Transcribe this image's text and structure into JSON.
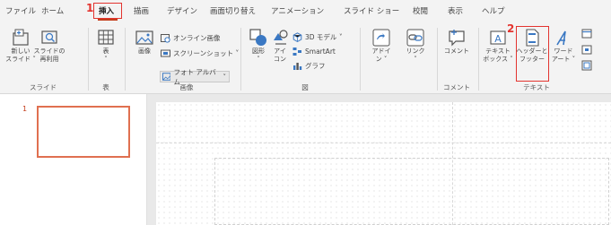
{
  "tabs": [
    {
      "id": "file",
      "label": "ファイル"
    },
    {
      "id": "home",
      "label": "ホーム"
    },
    {
      "id": "insert",
      "label": "挿入"
    },
    {
      "id": "draw",
      "label": "描画"
    },
    {
      "id": "design",
      "label": "デザイン"
    },
    {
      "id": "transitions",
      "label": "画面切り替え"
    },
    {
      "id": "animations",
      "label": "アニメーション"
    },
    {
      "id": "slideshow",
      "label": "スライド ショー"
    },
    {
      "id": "review",
      "label": "校閲"
    },
    {
      "id": "view",
      "label": "表示"
    },
    {
      "id": "help",
      "label": "ヘルプ"
    }
  ],
  "active_tab": "挿入",
  "steps": {
    "one": "1",
    "two": "2"
  },
  "ribbon": {
    "new_slide": {
      "line1": "新しい",
      "line2": "スライド ˅"
    },
    "reuse_slide": {
      "line1": "スライドの",
      "line2": "再利用"
    },
    "table": {
      "line1": "表",
      "line2": "˅"
    },
    "picture": {
      "line1": "画像"
    },
    "online_pictures": "オンライン画像",
    "screenshot": "スクリーンショット ˅",
    "photo_album": "フォト アルバム",
    "shapes": {
      "line1": "図形",
      "line2": "˅"
    },
    "icons": {
      "line1": "アイ",
      "line2": "コン"
    },
    "models_3d": "3D モデル ˅",
    "smartart": "SmartArt",
    "chart": "グラフ",
    "action": {
      "line1": "アドイ",
      "line2": "ン ˅"
    },
    "link": {
      "line1": "リンク",
      "line2": "˅"
    },
    "comment": {
      "line1": "コメント"
    },
    "textbox": {
      "line1": "テキスト",
      "line2": "ボックス ˅"
    },
    "header_footer": {
      "line1": "ヘッダーと",
      "line2": "フッター"
    },
    "wordart": {
      "line1": "ワード",
      "line2": "アート ˅"
    }
  },
  "groups": {
    "slides": "スライド",
    "tables": "表",
    "images": "画像",
    "illustrations": "図",
    "comments": "コメント",
    "text": "テキスト"
  },
  "slides_pane": {
    "slide_number": "1"
  },
  "colors": {
    "accent": "#c43e1c",
    "highlight": "#e3342f",
    "icon_blue": "#3a78c3",
    "icon_dark": "#555555"
  }
}
